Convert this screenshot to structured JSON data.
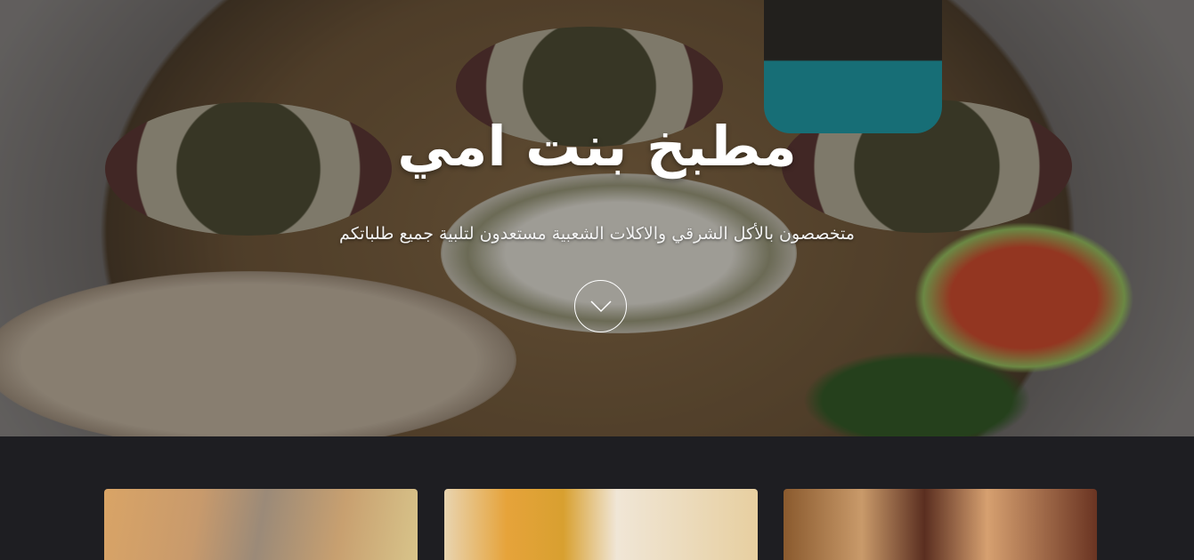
{
  "hero": {
    "title": "مطبخ بنت امي",
    "subtitle": "متخصصون بالأكل الشرقي والاكلات الشعبية مستعدون لتلبية جميع طلباتكم",
    "scroll_icon": "chevron-down-icon"
  },
  "cards": [
    {
      "image": "food-image-1"
    },
    {
      "image": "food-image-2"
    },
    {
      "image": "food-image-3"
    }
  ],
  "colors": {
    "background": "#1e1e22",
    "text": "#ffffff"
  }
}
